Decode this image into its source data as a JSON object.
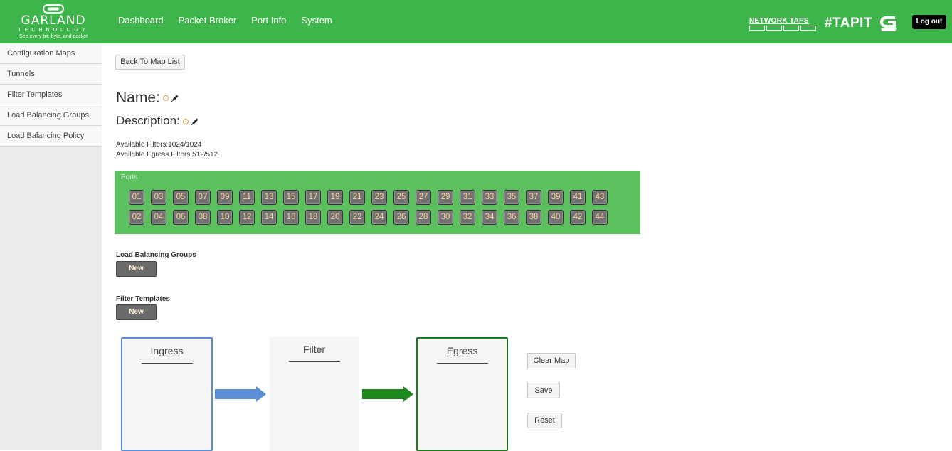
{
  "header": {
    "logo": {
      "brand": "GARLAND",
      "sub": "TECHNOLOGY",
      "tagline": "See every bit, byte, and packet"
    },
    "nav": [
      "Dashboard",
      "Packet Broker",
      "Port Info",
      "System"
    ],
    "network_taps": "NETWORK TAPS",
    "hashtag": "#TAPIT",
    "logout_label": "Log out",
    "brand_color": "#3db54a"
  },
  "sidebar": {
    "items": [
      "Configuration Maps",
      "Tunnels",
      "Filter Templates",
      "Load Balancing Groups",
      "Load Balancing Policy"
    ]
  },
  "main": {
    "back_label": "Back To Map List",
    "name_label": "Name:",
    "description_label": "Description:",
    "available_filters": "Available Filters:1024/1024",
    "available_egress_filters": "Available Egress Filters:512/512",
    "ports": {
      "label": "Ports",
      "top_row": [
        "01",
        "03",
        "05",
        "07",
        "09",
        "11",
        "13",
        "15",
        "17",
        "19",
        "21",
        "23",
        "25",
        "27",
        "29",
        "31",
        "33",
        "35",
        "37",
        "39",
        "41",
        "43"
      ],
      "bottom_row": [
        "02",
        "04",
        "06",
        "08",
        "10",
        "12",
        "14",
        "16",
        "18",
        "20",
        "22",
        "24",
        "26",
        "28",
        "30",
        "32",
        "34",
        "36",
        "38",
        "40",
        "42",
        "44"
      ]
    },
    "lb_groups": {
      "title": "Load Balancing Groups",
      "new_label": "New"
    },
    "filter_templates": {
      "title": "Filter Templates",
      "new_label": "New"
    },
    "stages": {
      "ingress": "Ingress",
      "filter": "Filter",
      "egress": "Egress"
    },
    "actions": {
      "clear": "Clear Map",
      "save": "Save",
      "reset": "Reset"
    }
  }
}
